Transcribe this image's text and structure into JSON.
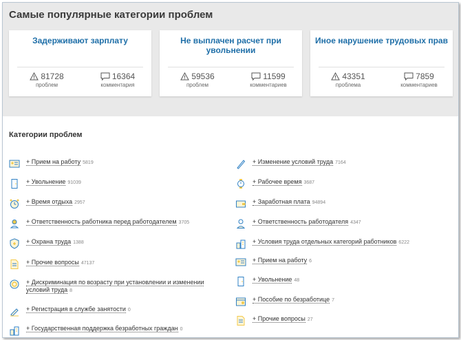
{
  "page_title": "Самые популярные категории проблем",
  "cards": [
    {
      "title": "Задерживают зарплату",
      "problems": "81728",
      "problems_label": "проблем",
      "comments": "16364",
      "comments_label": "комментария"
    },
    {
      "title": "Не выплачен расчет при увольнении",
      "problems": "59536",
      "problems_label": "проблем",
      "comments": "11599",
      "comments_label": "комментариев"
    },
    {
      "title": "Иное нарушение трудовых прав",
      "problems": "43351",
      "problems_label": "проблема",
      "comments": "7859",
      "comments_label": "комментариев"
    }
  ],
  "categories_title": "Категории проблем",
  "left": [
    {
      "label": "Прием на работу",
      "count": "5819",
      "icon": "id-card-icon"
    },
    {
      "label": "Увольнение",
      "count": "91039",
      "icon": "door-icon"
    },
    {
      "label": "Время отдыха",
      "count": "2957",
      "icon": "alarm-clock-icon"
    },
    {
      "label": "Ответственность работника перед работодателем",
      "count": "3705",
      "icon": "worker-icon"
    },
    {
      "label": "Охрана труда",
      "count": "1388",
      "icon": "shield-icon"
    },
    {
      "label": "Прочие вопросы",
      "count": "47137",
      "icon": "document-icon"
    },
    {
      "label": "Дискриминация по возрасту при установлении и изменении",
      "label2": "условий труда",
      "count": "8",
      "icon": "badge-icon"
    },
    {
      "label": "Регистрация в службе занятости",
      "count": "0",
      "icon": "pen-icon"
    },
    {
      "label": "Государственная поддержка безработных граждан",
      "count": "0",
      "icon": "buildings-icon"
    }
  ],
  "right": [
    {
      "label": "Изменение условий труда",
      "count": "7164",
      "icon": "pencil-icon"
    },
    {
      "label": "Рабочее время",
      "count": "3687",
      "icon": "watch-icon"
    },
    {
      "label": "Заработная плата",
      "count": "94894",
      "icon": "wallet-icon"
    },
    {
      "label": "Ответственность работодателя",
      "count": "4347",
      "icon": "person-icon"
    },
    {
      "label": "Условия труда отдельных категорий работников",
      "count": "6222",
      "icon": "buildings-icon"
    },
    {
      "label": "Прием на работу",
      "count": "6",
      "icon": "id-card-icon"
    },
    {
      "label": "Увольнение",
      "count": "48",
      "icon": "door-icon"
    },
    {
      "label": "Пособие по безработице",
      "count": "7",
      "icon": "calendar-money-icon"
    },
    {
      "label": "Прочие вопросы",
      "count": "27",
      "icon": "document-icon"
    }
  ],
  "colors": {
    "accent": "#1f6fa8",
    "icon_yellow": "#f2c94c",
    "icon_blue": "#2f80c4"
  }
}
